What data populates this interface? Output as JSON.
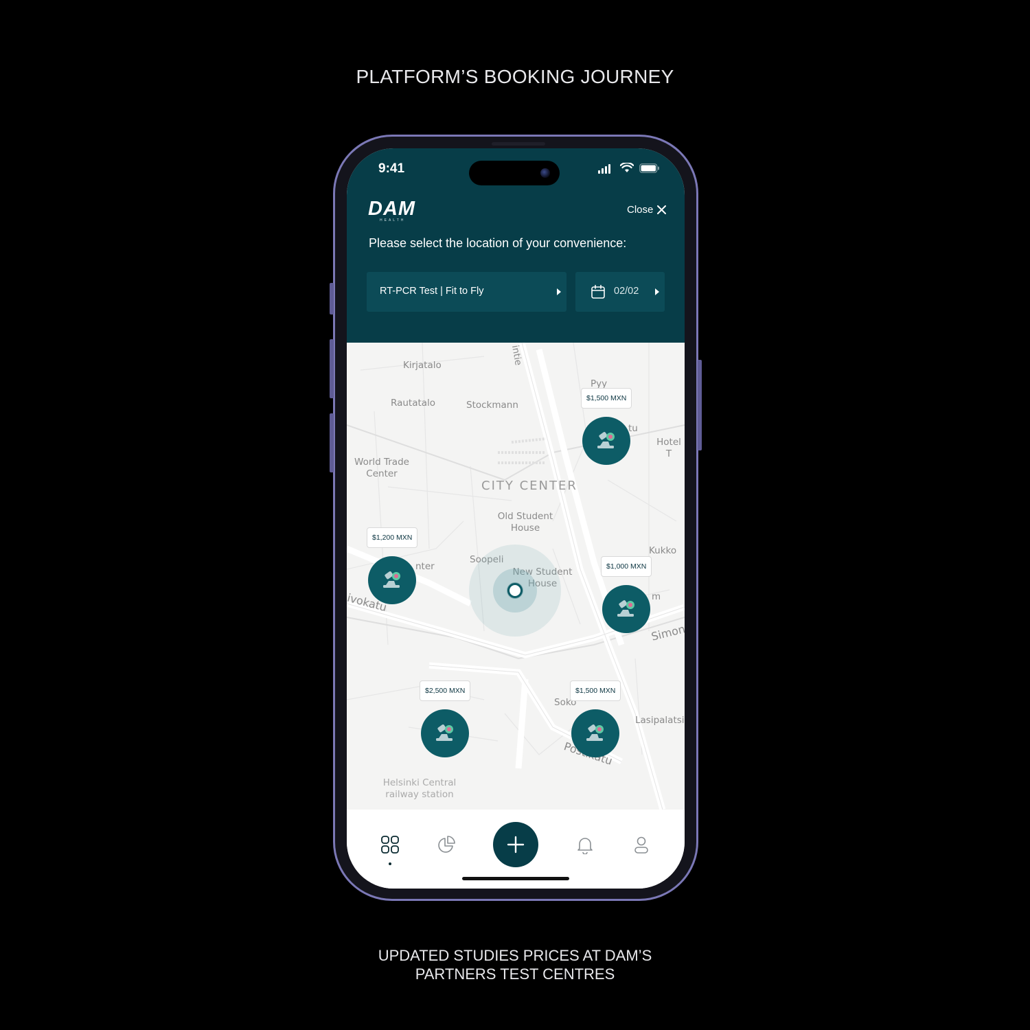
{
  "captions": {
    "top": "PLATFORM’S BOOKING JOURNEY",
    "bottom_line1": "UPDATED STUDIES PRICES AT DAM’S",
    "bottom_line2": "PARTNERS TEST CENTRES"
  },
  "status_bar": {
    "time": "9:41"
  },
  "header": {
    "logo": "DAM",
    "logo_sub": "HEALTH",
    "close_label": "Close",
    "prompt": "Please select the location of your convenience:",
    "test_selector": "RT-PCR Test | Fit to Fly",
    "date_selector": "02/02"
  },
  "map": {
    "labels": {
      "kirjatalo": "Kirjatalo",
      "rautatalo": "Rautatalo",
      "stockmann": "Stockmann",
      "pyy": "Pyy",
      "tu": "tu",
      "hotel": "Hotel T",
      "world_trade_1": "World Trade",
      "world_trade_2": "Center",
      "city_center": "CITY CENTER",
      "old_student_1": "Old Student",
      "old_student_2": "House",
      "kukko": "Kukko",
      "soopeli": "Soopeli",
      "new_student_1": "New Student",
      "new_student_2": "House",
      "nter": "nter",
      "ivokatu": "ivokatu",
      "m": "m",
      "simon": "Simon",
      "sokos": "Soko",
      "postikatu": "Postikatu",
      "lasipalatsi": "Lasipalatsi",
      "helsinki_1": "Helsinki Central",
      "helsinki_2": "railway station",
      "intie": "intie"
    },
    "prices": {
      "p1": "$1,500 MXN",
      "p2": "$1,200 MXN",
      "p3": "$1,000 MXN",
      "p4": "$2,500 MXN",
      "p5": "$1,500 MXN"
    }
  },
  "colors": {
    "header_bg": "#073d48",
    "pin_bg": "#0d5c66",
    "accent": "#073d48"
  },
  "tabbar": {
    "items": [
      "grid-icon",
      "pie-chart-icon",
      "plus-icon",
      "bell-icon",
      "user-icon"
    ]
  }
}
